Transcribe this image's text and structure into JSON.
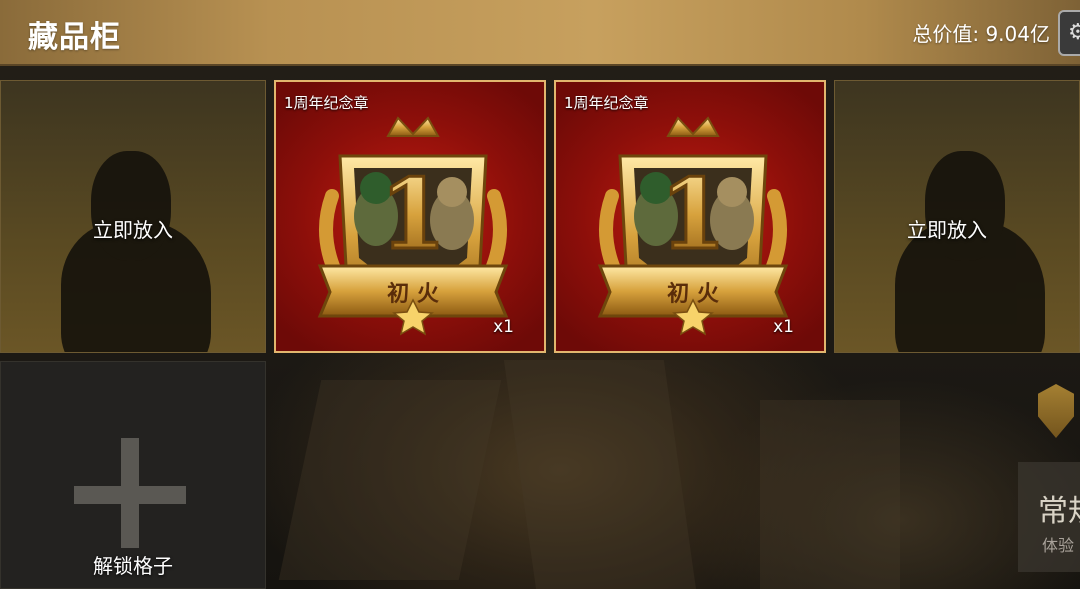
{
  "header": {
    "title": "藏品柜",
    "total_value": "总价值: 9.04亿"
  },
  "slots": [
    {
      "state": "empty",
      "label": "立即放入"
    },
    {
      "state": "filled",
      "name": "1周年纪念章",
      "medal_text": "初 火",
      "medal_number": "1",
      "count": "x1"
    },
    {
      "state": "filled",
      "name": "1周年纪念章",
      "medal_text": "初 火",
      "medal_number": "1",
      "count": "x1"
    },
    {
      "state": "empty",
      "label": "立即放入"
    },
    {
      "state": "locked",
      "label": "解锁格子"
    }
  ],
  "side_panel": {
    "title": "常规",
    "subtitle": "体验"
  },
  "colors": {
    "header_gold": "#c7a05e",
    "filled_slot_red": "#c21c10",
    "slot_border_gold": "#e2b66e"
  }
}
